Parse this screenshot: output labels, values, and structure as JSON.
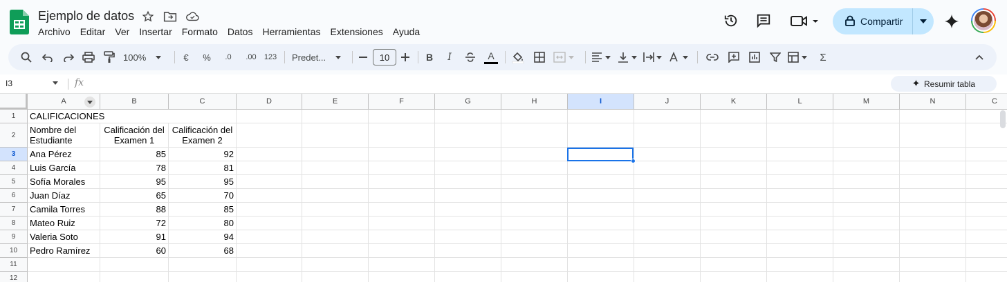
{
  "app": {
    "title": "Ejemplo de datos",
    "menu": [
      "Archivo",
      "Editar",
      "Ver",
      "Insertar",
      "Formato",
      "Datos",
      "Herramientas",
      "Extensiones",
      "Ayuda"
    ],
    "share_label": "Compartir",
    "icons": [
      "star-icon",
      "move-folder-icon",
      "cloud-status-icon",
      "history-icon",
      "comment-icon",
      "video-call-icon",
      "gemini-icon"
    ]
  },
  "toolbar": {
    "zoom": "100%",
    "currency": "€",
    "percent": "%",
    "decrease_decimals": ".0",
    "increase_decimals": ".00",
    "number_format": "123",
    "font": "Predet...",
    "font_size": "10",
    "bold": "B",
    "italic": "I",
    "text_color": "A"
  },
  "formula_bar": {
    "name_box": "I3",
    "fx": "fx",
    "summarize_label": "Resumir tabla"
  },
  "sheet": {
    "columns": [
      "A",
      "B",
      "C",
      "D",
      "E",
      "F",
      "G",
      "H",
      "I",
      "J",
      "K",
      "L",
      "M",
      "N",
      "C"
    ],
    "rows": [
      "1",
      "2",
      "3",
      "4",
      "5",
      "6",
      "7",
      "8",
      "9",
      "10",
      "11",
      "12"
    ],
    "selected_cell": "I3",
    "title_cell": "CALIFICACIONES",
    "headers": [
      "Nombre del Estudiante",
      "Calificación del Examen 1",
      "Calificación del Examen 2"
    ],
    "records": [
      {
        "name": "Ana Pérez",
        "exam1": "85",
        "exam2": "92"
      },
      {
        "name": "Luis García",
        "exam1": "78",
        "exam2": "81"
      },
      {
        "name": "Sofía Morales",
        "exam1": "95",
        "exam2": "95"
      },
      {
        "name": "Juan Díaz",
        "exam1": "65",
        "exam2": "70"
      },
      {
        "name": "Camila Torres",
        "exam1": "88",
        "exam2": "85"
      },
      {
        "name": "Mateo Ruiz",
        "exam1": "72",
        "exam2": "80"
      },
      {
        "name": "Valeria Soto",
        "exam1": "91",
        "exam2": "94"
      },
      {
        "name": "Pedro Ramírez",
        "exam1": "60",
        "exam2": "68"
      }
    ]
  },
  "colors": {
    "accent": "#1a73e8",
    "share_bg": "#c2e7ff",
    "toolbar_bg": "#edf2fa",
    "logo": "#0f9d58"
  }
}
